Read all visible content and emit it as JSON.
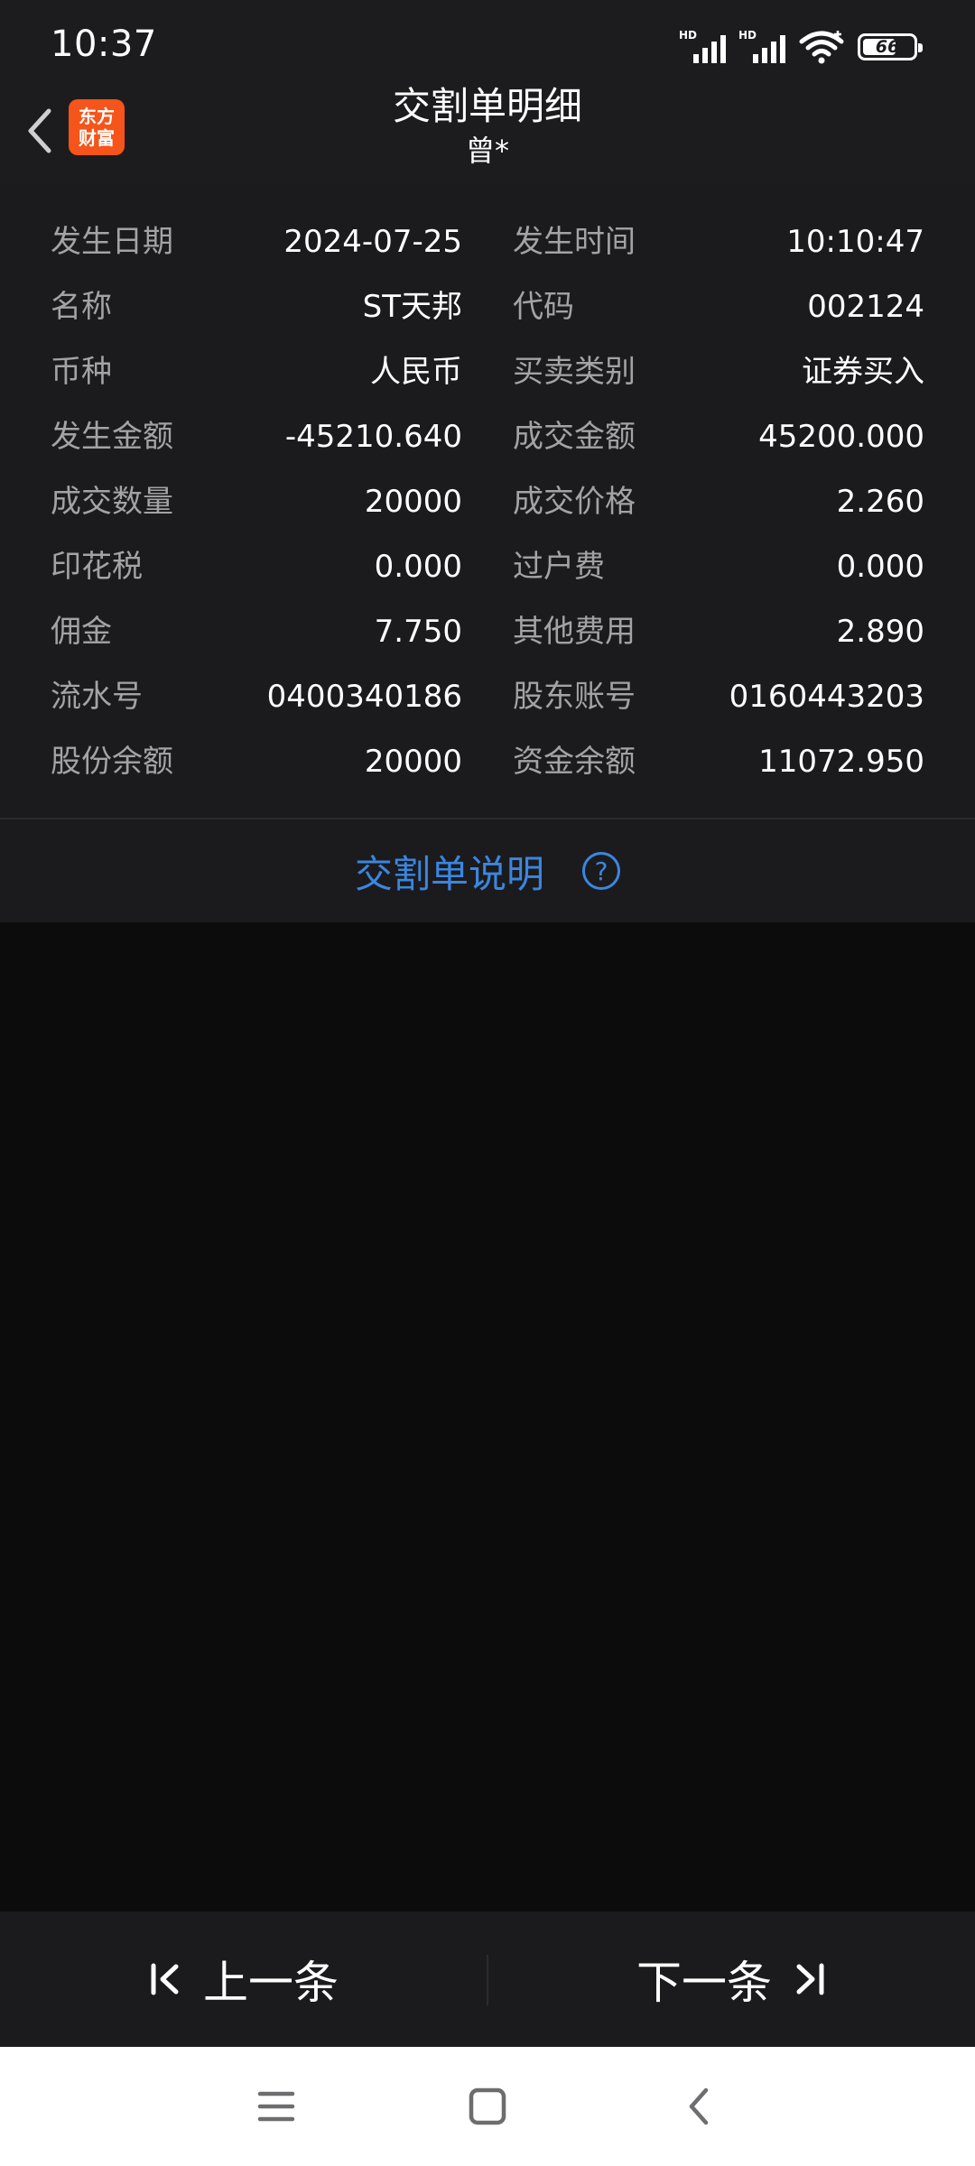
{
  "status_bar": {
    "time": "10:37",
    "signal_1_label": "HD",
    "signal_2_label": "HD",
    "battery_level": "66",
    "battery_fraction": 0.66
  },
  "header": {
    "title": "交割单明细",
    "subtitle": "曾*",
    "logo_line1": "东方",
    "logo_line2": "财富",
    "logo_color": "#f5541a"
  },
  "details": [
    {
      "label1": "发生日期",
      "value1": "2024-07-25",
      "label2": "发生时间",
      "value2": "10:10:47"
    },
    {
      "label1": "名称",
      "value1": "ST天邦",
      "label2": "代码",
      "value2": "002124"
    },
    {
      "label1": "币种",
      "value1": "人民币",
      "label2": "买卖类别",
      "value2": "证券买入"
    },
    {
      "label1": "发生金额",
      "value1": "-45210.640",
      "label2": "成交金额",
      "value2": "45200.000"
    },
    {
      "label1": "成交数量",
      "value1": "20000",
      "label2": "成交价格",
      "value2": "2.260"
    },
    {
      "label1": "印花税",
      "value1": "0.000",
      "label2": "过户费",
      "value2": "0.000"
    },
    {
      "label1": "佣金",
      "value1": "7.750",
      "label2": "其他费用",
      "value2": "2.890"
    },
    {
      "label1": "流水号",
      "value1": "0400340186",
      "label2": "股东账号",
      "value2": "0160443203"
    },
    {
      "label1": "股份余额",
      "value1": "20000",
      "label2": "资金余额",
      "value2": "11072.950"
    }
  ],
  "explain": {
    "link_label": "交割单说明",
    "help_glyph": "?",
    "accent_color": "#3b86e0"
  },
  "bottom_nav": {
    "prev_label": "上一条",
    "next_label": "下一条"
  },
  "icons": {
    "back": "chevron-left-icon",
    "first": "skip-prev-icon",
    "last": "skip-next-icon",
    "system_menu": "menu-icon",
    "system_home": "home-square-icon",
    "system_back": "back-chevron-icon"
  }
}
